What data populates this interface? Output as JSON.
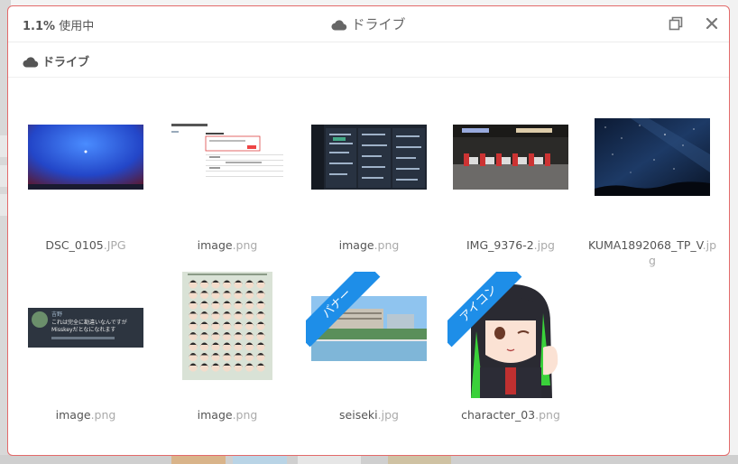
{
  "header": {
    "usage_percent": "1.1%",
    "usage_label": "使用中",
    "title": "ドライブ"
  },
  "breadcrumb": {
    "label": "ドライブ"
  },
  "files": [
    {
      "name": "DSC_0105",
      "ext": ".JPG",
      "thumb": "desktop-blue"
    },
    {
      "name": "image",
      "ext": ".png",
      "thumb": "document-screenshot"
    },
    {
      "name": "image",
      "ext": ".png",
      "thumb": "dark-timeline"
    },
    {
      "name": "IMG_9376-2",
      "ext": ".jpg",
      "thumb": "station-gates"
    },
    {
      "name": "KUMA1892068_TP_V",
      "ext": ".jpg",
      "thumb": "night-sky"
    },
    {
      "name": "image",
      "ext": ".png",
      "thumb": "note-card"
    },
    {
      "name": "image",
      "ext": ".png",
      "thumb": "emoji-grid"
    },
    {
      "name": "seiseki",
      "ext": ".jpg",
      "thumb": "school-photo",
      "ribbon": "バナー"
    },
    {
      "name": "character_03",
      "ext": ".png",
      "thumb": "anime-character",
      "ribbon": "アイコン"
    }
  ],
  "note_card": {
    "user": "吉野",
    "line1": "これは完全に勘違いなんですが",
    "line2": "Misskeyだとなになれます"
  },
  "colors": {
    "accent": "#1e8ee8",
    "border": "#e36a6a"
  }
}
